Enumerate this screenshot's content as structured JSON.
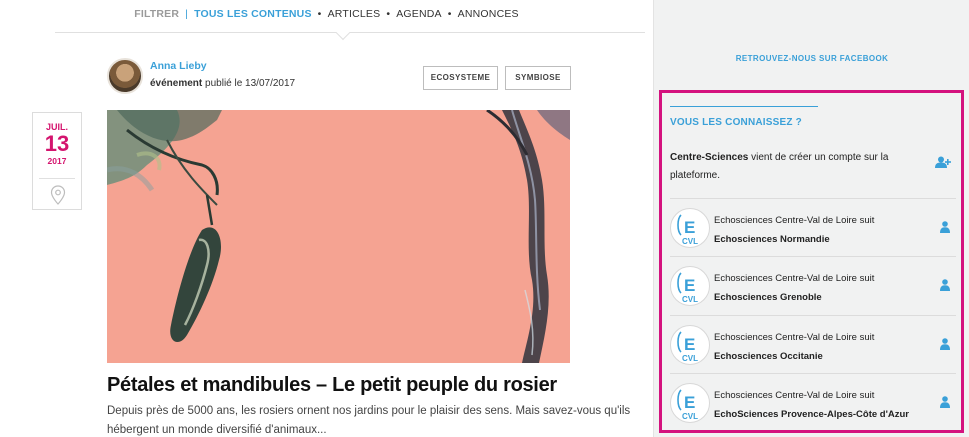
{
  "filter": {
    "label": "FILTRER",
    "separator": "|",
    "active": "TOUS LES CONTENUS",
    "items": [
      "ARTICLES",
      "AGENDA",
      "ANNONCES"
    ]
  },
  "post": {
    "author": "Anna Lieby",
    "type": "événement",
    "published": "publié le 13/07/2017",
    "tags": [
      "ECOSYSTEME",
      "SYMBIOSE"
    ],
    "date": {
      "month": "JUIL.",
      "day": "13",
      "year": "2017"
    },
    "title": "Pétales et mandibules – Le petit peuple du rosier",
    "excerpt": "Depuis près de 5000 ans, les rosiers ornent nos jardins pour le plaisir des sens. Mais savez-vous qu'ils hébergent un monde diversifié d'animaux..."
  },
  "sidebar": {
    "facebook": "RETROUVEZ-NOUS SUR FACEBOOK",
    "knows_title": "VOUS LES CONNAISSEZ ?",
    "first": {
      "name": "Centre-Sciences",
      "text": " vient de créer un compte sur la plateforme."
    },
    "follows": [
      {
        "who": "Echosciences Centre-Val de Loire",
        "verb": " suit",
        "target": "Echosciences Normandie"
      },
      {
        "who": "Echosciences Centre-Val de Loire",
        "verb": " suit",
        "target": "Echosciences Grenoble"
      },
      {
        "who": "Echosciences Centre-Val de Loire",
        "verb": " suit",
        "target": "Echosciences Occitanie"
      },
      {
        "who": "Echosciences Centre-Val de Loire",
        "verb": " suit",
        "target": "EchoSciences Provence-Alpes-Côte d'Azur"
      }
    ],
    "logo_text": "CVL"
  },
  "colors": {
    "accent_blue": "#3aa0d8",
    "accent_pink": "#d4146e",
    "highlight_border": "#d4127e",
    "hero_bg": "#f5a392"
  }
}
